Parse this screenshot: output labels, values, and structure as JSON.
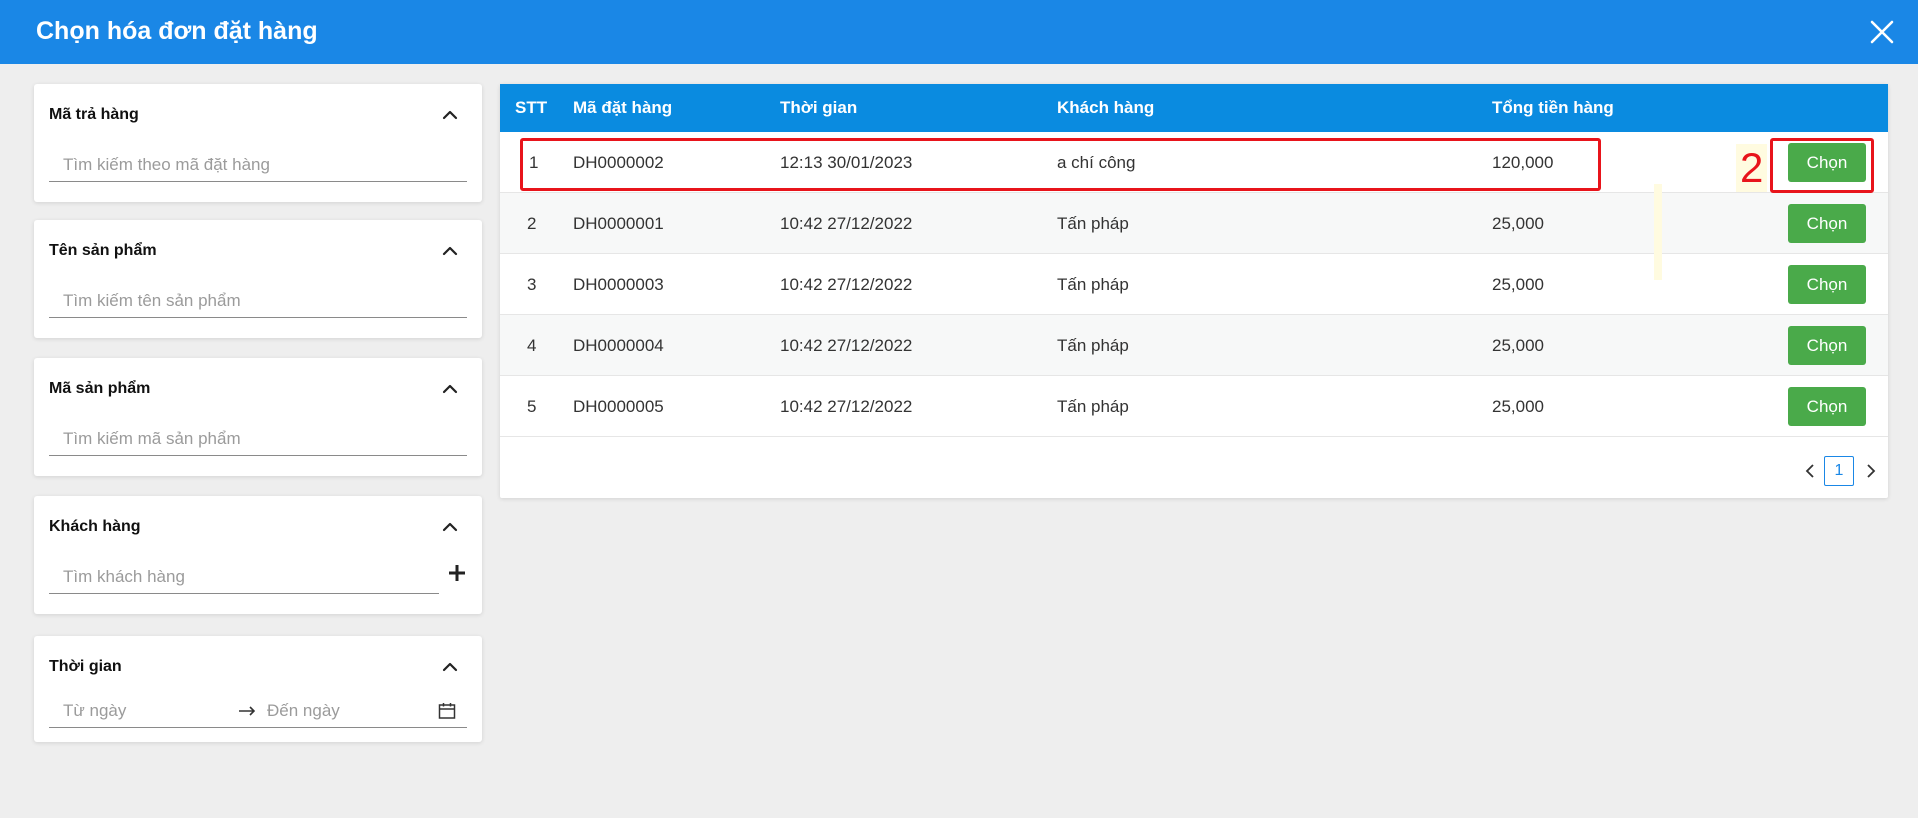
{
  "header": {
    "title": "Chọn hóa đơn đặt hàng"
  },
  "filters": [
    {
      "title": "Mã trả hàng",
      "placeholder": "Tìm kiếm theo mã đặt hàng"
    },
    {
      "title": "Tên sản phẩm",
      "placeholder": "Tìm kiếm tên sản phẩm"
    },
    {
      "title": "Mã sản phẩm",
      "placeholder": "Tìm kiếm mã sản phẩm"
    },
    {
      "title": "Khách hàng",
      "placeholder": "Tìm khách hàng"
    },
    {
      "title": "Thời gian",
      "from_placeholder": "Từ ngày",
      "to_placeholder": "Đến ngày"
    }
  ],
  "table": {
    "columns": [
      "STT",
      "Mã đặt hàng",
      "Thời gian",
      "Khách hàng",
      "Tổng tiền hàng"
    ],
    "select_label": "Chọn",
    "rows": [
      {
        "stt": "1",
        "code": "DH0000002",
        "time": "12:13 30/01/2023",
        "customer": "a chí công",
        "total": "120,000"
      },
      {
        "stt": "2",
        "code": "DH0000001",
        "time": "10:42 27/12/2022",
        "customer": "Tấn pháp",
        "total": "25,000"
      },
      {
        "stt": "3",
        "code": "DH0000003",
        "time": "10:42 27/12/2022",
        "customer": "Tấn pháp",
        "total": "25,000"
      },
      {
        "stt": "4",
        "code": "DH0000004",
        "time": "10:42 27/12/2022",
        "customer": "Tấn pháp",
        "total": "25,000"
      },
      {
        "stt": "5",
        "code": "DH0000005",
        "time": "10:42 27/12/2022",
        "customer": "Tấn pháp",
        "total": "25,000"
      }
    ]
  },
  "pagination": {
    "current": "1"
  },
  "annotation": {
    "number": "2"
  },
  "colors": {
    "header": "#1a87e6",
    "table_header": "#0a8be0",
    "button": "#4aaa4a",
    "annotation": "#e8141b"
  },
  "icons": [
    "close-icon",
    "chevron-up-icon",
    "plus-icon",
    "arrow-right-icon",
    "calendar-icon",
    "chevron-left-icon",
    "chevron-right-icon"
  ]
}
